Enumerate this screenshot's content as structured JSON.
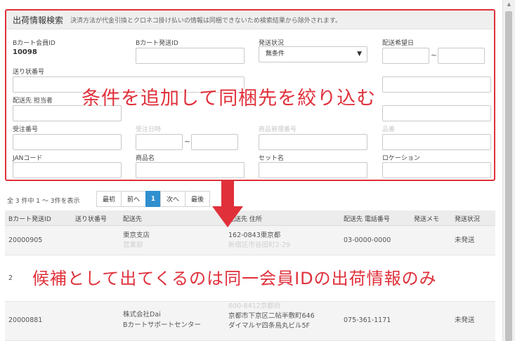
{
  "search": {
    "title": "出荷情報検索",
    "note": "決済方法が代金引換とクロネコ掛け払いの情報は同梱できないため検索結果から除外されます。",
    "fields": {
      "member_id_label": "Bカート会員ID",
      "member_id_value": "10098",
      "shipping_id_label": "Bカート発送ID",
      "ship_status_label": "発送状況",
      "ship_status_value": "無条件",
      "desired_date_label": "配送希望日",
      "date_sep": "~",
      "tracking_label": "送り状番号",
      "recipient_label": "配送先 担当者",
      "order_no_label": "受注番号",
      "order_date_label": "受注日時",
      "order_date_sep": "~",
      "product_mgmt_label": "商品管理番号",
      "partial_label": "品番",
      "jan_label": "JANコード",
      "product_name_label": "商品名",
      "set_name_label": "セット名",
      "location_label": "ロケーション"
    }
  },
  "callouts": {
    "top": "条件を追加して同梱先を絞り込む",
    "bottom": "候補として出てくるのは同一会員IDの出荷情報のみ"
  },
  "pagination": {
    "summary": "全 3 件中 1 ～ 3件を表示",
    "buttons": [
      "最初",
      "前へ",
      "1",
      "次へ",
      "最後"
    ]
  },
  "table": {
    "headers": [
      "Bカート発送ID",
      "送り状番号",
      "配送先",
      "配送先 住所",
      "配送先 電話番号",
      "発送メモ",
      "発送状況"
    ],
    "rows": [
      {
        "id": "20000905",
        "tracking": "",
        "dest_line1": "東京支店",
        "dest_line2": "営業部",
        "addr_line1": "162-0843東京都",
        "addr_line2": "新宿区市谷田町2-29",
        "addr_line3": "",
        "phone": "03-0000-0000",
        "memo": "",
        "status": "未発送"
      },
      {
        "id": "2",
        "tracking": "",
        "dest_line1": "",
        "dest_line2": "",
        "addr_line1": "",
        "addr_line2": "",
        "addr_line3": "",
        "phone": "",
        "memo": "",
        "status": ""
      },
      {
        "id": "20000881",
        "tracking": "",
        "dest_line1": "株式会社Dai",
        "dest_line2": "Bカートサポートセンター",
        "addr_line1": "600-8412京都府",
        "addr_line2": "京都市下京区二帖半敷町646",
        "addr_line3": "ダイマルヤ四条烏丸ビル5F",
        "phone": "075-361-1171",
        "memo": "",
        "status": "未発送"
      }
    ]
  },
  "icons": {
    "arrow": "down-arrow-icon",
    "select_caret": "▼",
    "scroll_up": "▲"
  },
  "colors": {
    "accent_red": "#e0303a",
    "pager_active": "#2f8fcf"
  }
}
